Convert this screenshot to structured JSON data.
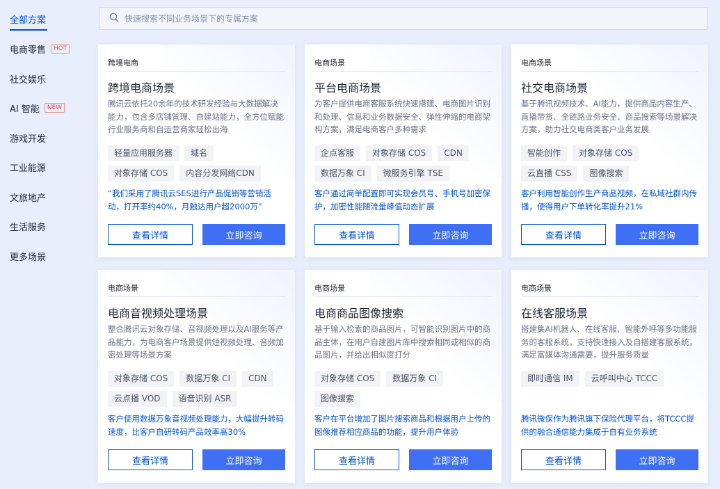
{
  "search": {
    "placeholder": "快速搜索不同业务场景下的专属方案"
  },
  "sidebar": {
    "items": [
      {
        "label": "全部方案",
        "badge": ""
      },
      {
        "label": "电商零售",
        "badge": "HOT"
      },
      {
        "label": "社交娱乐",
        "badge": ""
      },
      {
        "label": "AI 智能",
        "badge": "NEW"
      },
      {
        "label": "游戏开发",
        "badge": ""
      },
      {
        "label": "工业能源",
        "badge": ""
      },
      {
        "label": "文旅地产",
        "badge": ""
      },
      {
        "label": "生活服务",
        "badge": ""
      },
      {
        "label": "更多场景",
        "badge": ""
      }
    ]
  },
  "colors": {
    "accent": "#0052d9",
    "button_primary": "#3f6ff5",
    "hot_badge": "#f2572b",
    "new_badge": "#e54545"
  },
  "buttons": {
    "detail_label": "查看详情",
    "consult_label": "立即咨询"
  },
  "cards": [
    {
      "category": "跨境电商",
      "title": "跨境电商场景",
      "description": "腾讯云依托20余年的技术研发经验与大数据解决能力，包含多店铺管理、自建站能力，全方位赋能行业服务商和自运营商家轻松出海",
      "tags": [
        "轻量应用服务器",
        "域名",
        "对象存储 COS",
        "内容分发网络CDN"
      ],
      "quote": "“我们采用了腾讯云SES进行产品促销等营销活动，打开率约40%，月触达用户超2000万”"
    },
    {
      "category": "电商场景",
      "title": "平台电商场景",
      "description": "为客户提供电商客服系统快速搭建、电商图片识别和处理、信息和业务数据安全、弹性伸缩的电商架构方案，满足电商客户多种需求",
      "tags": [
        "企点客服",
        "对象存储 COS",
        "CDN",
        "数据万象 CI",
        "微服务引擎 TSE"
      ],
      "quote": "客户通过简单配置即可实现会员号、手机号加密保护，加密性能随流量峰值动态扩展"
    },
    {
      "category": "电商场景",
      "title": "社交电商场景",
      "description": "基于腾讯视频技术、AI能力，提供商品内容生产、直播带货、全链路业务安全、商品搜索等场景解决方案，助力社交电商类客户业务发展",
      "tags": [
        "智能创作",
        "对象存储 COS",
        "云直播 CSS",
        "图像搜索"
      ],
      "quote": "客户利用智能创作生产商品视频，在私域社群内传播，使得用户下单转化率提升21%"
    },
    {
      "category": "电商场景",
      "title": "电商音视频处理场景",
      "description": "整合腾讯云对象存储、音视频处理以及AI服务等产品能力，为电商客户场景提供短视频处理、音频加密处理等场景方案",
      "tags": [
        "对象存储 COS",
        "数据万象 CI",
        "CDN",
        "云点播 VOD",
        "语音识别 ASR"
      ],
      "quote": "客户使用数据万象音视频处理能力，大幅提升转码速度，比客户自研转码产品效率高30%"
    },
    {
      "category": "电商场景",
      "title": "电商商品图像搜索",
      "description": "基于输入检索的商品图片，可智能识别图片中的商品主体，在用户自建图片库中搜索相同或相似的商品图片，并给出相似度打分",
      "tags": [
        "对象存储 COS",
        "数据万象 CI",
        "图像搜索"
      ],
      "quote": "客户在平台增加了图片搜索商品和根据用户上传的图像推荐相应商品的功能，提升用户体验"
    },
    {
      "category": "电商场景",
      "title": "在线客服场景",
      "description": "搭建集AI机器人、在线客服、智能外呼等多功能服务的客服系统，支持快速接入及自搭建客服系统，满足富媒体沟通需要，提升服务质量",
      "tags": [
        "即时通信 IM",
        "云呼叫中心 TCCC"
      ],
      "quote": "腾讯微保作为腾讯旗下保险代理平台，将TCCC提供的融合通信能力集成于自有业务系统"
    }
  ]
}
